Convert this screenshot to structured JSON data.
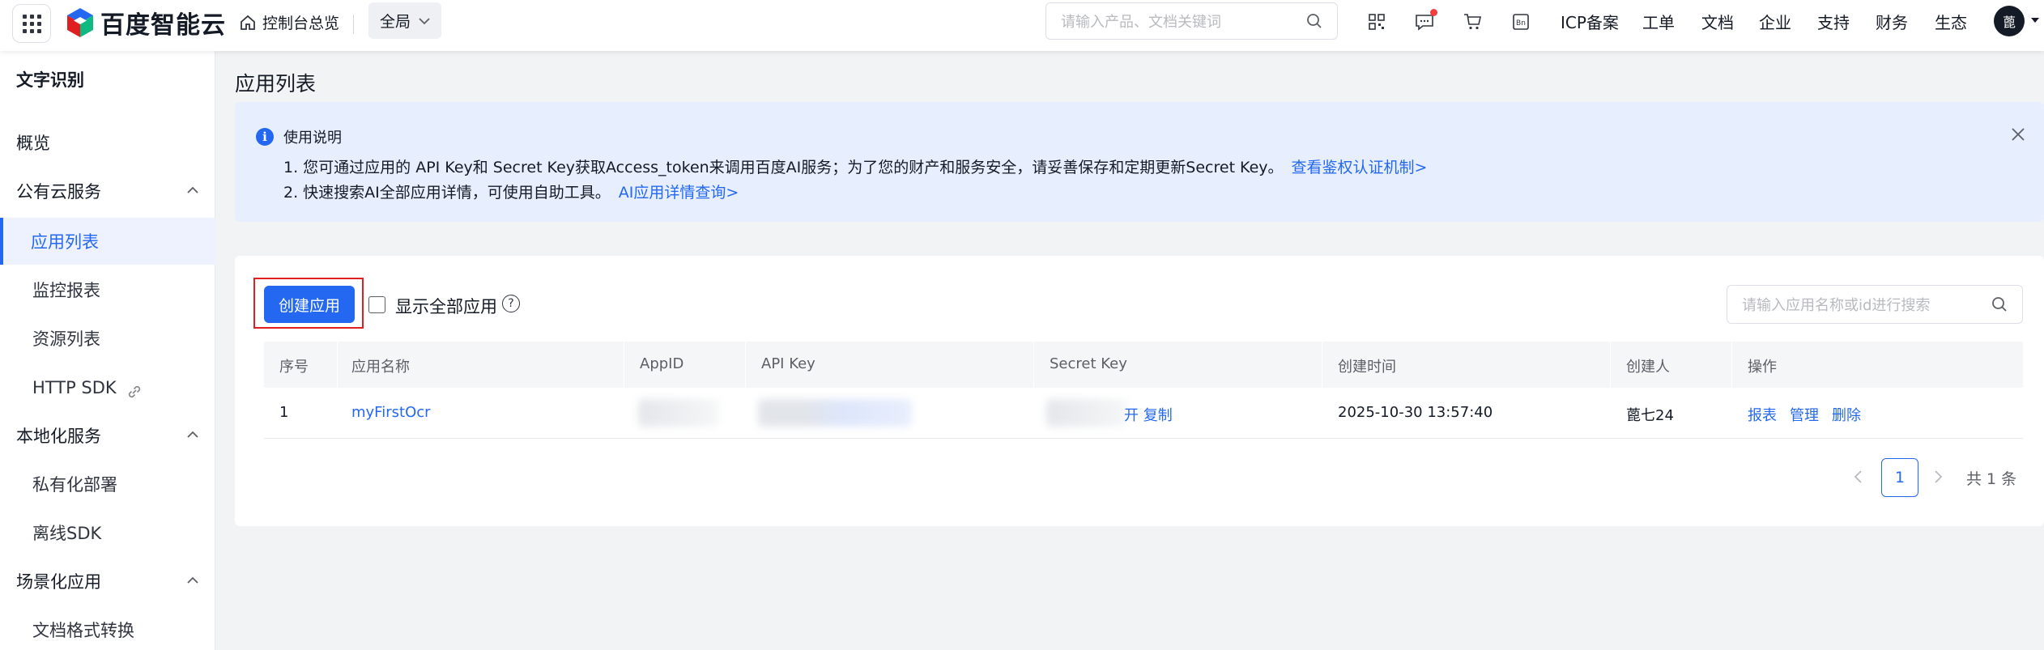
{
  "header": {
    "brand": "百度智能云",
    "home_label": "控制台总览",
    "region_label": "全局",
    "search_placeholder": "请输入产品、文档关键词",
    "nav_links": [
      "ICP备案",
      "工单",
      "文档",
      "企业",
      "支持",
      "财务",
      "生态"
    ],
    "avatar_text": "蓖",
    "icons": [
      "apps-grid-icon",
      "qrcode-icon",
      "message-icon",
      "cart-icon",
      "billing-icon",
      "search-icon"
    ],
    "colors": {
      "accent": "#2468f2",
      "notify_dot": "#f33e3e"
    }
  },
  "sidebar": {
    "title": "文字识别",
    "items": [
      {
        "label": "概览",
        "level": 1
      },
      {
        "label": "公有云服务",
        "level": 1,
        "expanded": true
      },
      {
        "label": "应用列表",
        "level": 2,
        "active": true
      },
      {
        "label": "监控报表",
        "level": 2
      },
      {
        "label": "资源列表",
        "level": 2
      },
      {
        "label": "HTTP SDK",
        "level": 2,
        "external": true
      },
      {
        "label": "本地化服务",
        "level": 1,
        "expanded": true
      },
      {
        "label": "私有化部署",
        "level": 2
      },
      {
        "label": "离线SDK",
        "level": 2
      },
      {
        "label": "场景化应用",
        "level": 1,
        "expanded": true
      },
      {
        "label": "文档格式转换",
        "level": 2
      }
    ]
  },
  "main": {
    "title": "应用列表",
    "notice": {
      "title": "使用说明",
      "line1": "1. 您可通过应用的 API Key和 Secret Key获取Access_token来调用百度AI服务；为了您的财产和服务安全，请妥善保存和定期更新Secret Key。",
      "line1_link": "查看鉴权认证机制>",
      "line2": "2. 快速搜索AI全部应用详情，可使用自助工具。",
      "line2_link": "AI应用详情查询>"
    },
    "toolbar": {
      "create_label": "创建应用",
      "show_all_label": "显示全部应用",
      "search_placeholder": "请输入应用名称或id进行搜索"
    },
    "table": {
      "columns": [
        "序号",
        "应用名称",
        "AppID",
        "API Key",
        "Secret Key",
        "创建时间",
        "创建人",
        "操作"
      ],
      "rows": [
        {
          "index": "1",
          "name": "myFirstOcr",
          "secret_action": "开 复制",
          "created_at": "2025-10-30 13:57:40",
          "creator": "蓖七24",
          "actions": [
            "报表",
            "管理",
            "删除"
          ]
        }
      ]
    },
    "pagination": {
      "current": "1",
      "total_text": "共 1 条"
    }
  }
}
